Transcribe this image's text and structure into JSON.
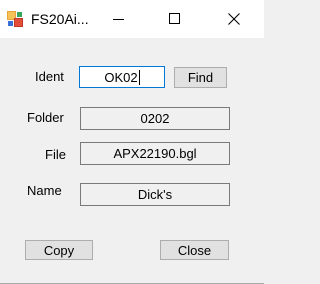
{
  "window": {
    "title": "FS20Ai..."
  },
  "form": {
    "ident_label": "Ident",
    "ident_value": "OK02",
    "find_label": "Find",
    "folder_label": "Folder",
    "folder_value": "0202",
    "file_label": "File",
    "file_value": "APX22190.bgl",
    "name_label": "Name",
    "name_value": "Dick's"
  },
  "buttons": {
    "copy_label": "Copy",
    "close_label": "Close"
  }
}
